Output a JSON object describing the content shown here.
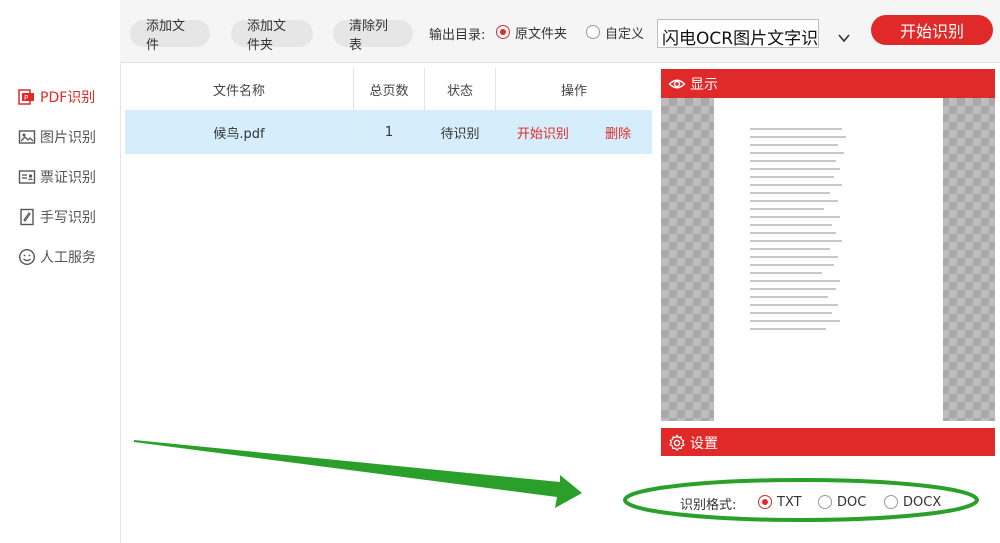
{
  "sidebar": {
    "items": [
      {
        "label": "PDF识别",
        "icon": "pdf-icon",
        "active": true
      },
      {
        "label": "图片识别",
        "icon": "image-icon",
        "active": false
      },
      {
        "label": "票证识别",
        "icon": "id-card-icon",
        "active": false
      },
      {
        "label": "手写识别",
        "icon": "handwriting-icon",
        "active": false
      },
      {
        "label": "人工服务",
        "icon": "smiley-icon",
        "active": false
      }
    ]
  },
  "toolbar": {
    "add_file_label": "添加文件",
    "add_folder_label": "添加文件夹",
    "clear_list_label": "清除列表",
    "output_dir_label": "输出目录:",
    "radio_original": "原文件夹",
    "radio_custom": "自定义",
    "output_path_value": "闪电OCR图片文字识别",
    "start_label": "开始识别"
  },
  "table": {
    "headers": [
      "文件名称",
      "总页数",
      "状态",
      "操作"
    ],
    "rows": [
      {
        "name": "候鸟.pdf",
        "pages": "1",
        "status": "待识别",
        "action_start": "开始识别",
        "action_delete": "删除"
      }
    ]
  },
  "preview_panel": {
    "title": "显示",
    "icon": "eye-icon"
  },
  "settings_panel": {
    "title": "设置",
    "icon": "gear-icon",
    "format_label": "识别格式:",
    "formats": [
      "TXT",
      "DOC",
      "DOCX"
    ],
    "selected_format": "TXT"
  },
  "colors": {
    "accent": "#e02a2a",
    "annotation": "#2aa02a",
    "selected_row": "#d6eefb"
  }
}
